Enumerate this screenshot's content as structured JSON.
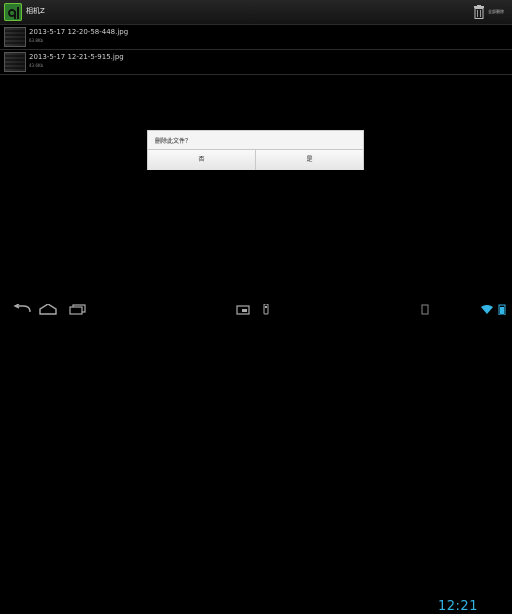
{
  "app": {
    "title": "相机Z",
    "delete_all_label": "全部删除"
  },
  "files": [
    {
      "name": "2013-5-17 12-20-58-448.jpg",
      "size": "63.8Kb"
    },
    {
      "name": "2013-5-17 12-21-5-915.jpg",
      "size": "43.6Kb"
    }
  ],
  "dialog": {
    "message": "删除此文件？",
    "no_label": "否",
    "yes_label": "是"
  },
  "statusbar": {
    "time": "12:21"
  },
  "colors": {
    "accent": "#33b5e5",
    "app_icon": "#2d7a2d",
    "background": "#000000"
  }
}
